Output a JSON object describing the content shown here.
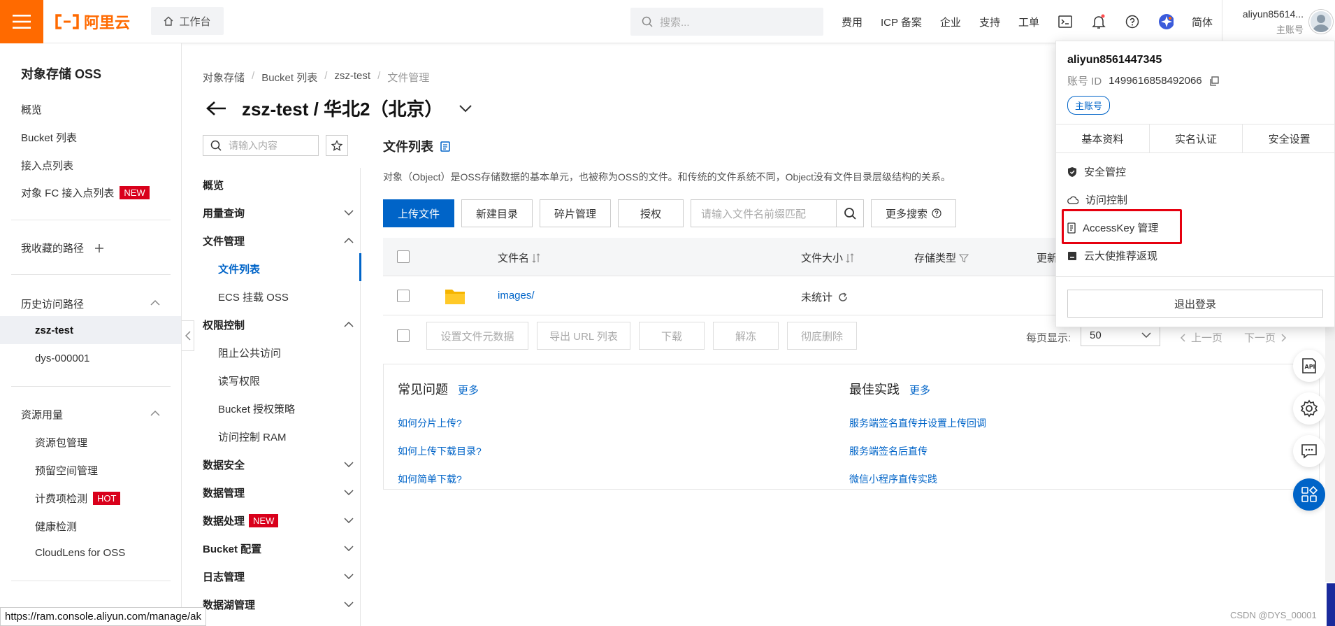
{
  "topbar": {
    "logo_text": "阿里云",
    "workbench": "工作台",
    "search_placeholder": "搜索...",
    "nav": [
      "费用",
      "ICP 备案",
      "企业",
      "支持",
      "工单"
    ],
    "lang": "简体",
    "user_name": "aliyun85614...",
    "user_role": "主账号"
  },
  "sidebar": {
    "title": "对象存储 OSS",
    "items": [
      "概览",
      "Bucket 列表",
      "接入点列表",
      "对象 FC 接入点列表"
    ],
    "fc_badge": "NEW",
    "favorites": "我收藏的路径",
    "history_title": "历史访问路径",
    "history": [
      "zsz-test",
      "dys-000001"
    ],
    "resources_title": "资源用量",
    "resources": [
      "资源包管理",
      "预留空间管理",
      "计费项检测",
      "健康检测",
      "CloudLens for OSS"
    ],
    "hot_badge": "HOT"
  },
  "breadcrumb": [
    "对象存储",
    "Bucket 列表",
    "zsz-test",
    "文件管理"
  ],
  "page_title": "zsz-test / 华北2（北京）",
  "bucket_nav": {
    "search_placeholder": "请输入内容",
    "items": [
      "概览",
      "用量查询",
      "文件管理",
      "文件列表",
      "ECS 挂载 OSS",
      "权限控制",
      "阻止公共访问",
      "读写权限",
      "Bucket 授权策略",
      "访问控制 RAM",
      "数据安全",
      "数据管理",
      "数据处理",
      "Bucket 配置",
      "日志管理",
      "数据湖管理"
    ],
    "new_badge": "NEW"
  },
  "main": {
    "title": "文件列表",
    "description": "对象（Object）是OSS存储数据的基本单元，也被称为OSS的文件。和传统的文件系统不同，Object没有文件目录层级结构的关系。",
    "buttons": [
      "上传文件",
      "新建目录",
      "碎片管理",
      "授权"
    ],
    "file_search_placeholder": "请输入文件名前缀匹配",
    "more_search": "更多搜索",
    "columns": [
      "文件名",
      "文件大小",
      "存储类型",
      "更新"
    ],
    "rows": [
      {
        "name": "images/",
        "size": "未统计"
      }
    ],
    "footer_buttons": [
      "设置文件元数据",
      "导出 URL 列表",
      "下载",
      "解冻",
      "彻底删除"
    ],
    "per_page_label": "每页显示:",
    "per_page": "50",
    "prev": "上一页",
    "next": "下一页"
  },
  "help": {
    "faq_title": "常见问题",
    "faq_more": "更多",
    "faq": [
      "如何分片上传?",
      "如何上传下载目录?",
      "如何简单下载?"
    ],
    "best_title": "最佳实践",
    "best_more": "更多",
    "best": [
      "服务端签名直传并设置上传回调",
      "服务端签名后直传",
      "微信小程序直传实践"
    ]
  },
  "user_dropdown": {
    "name": "aliyun8561447345",
    "id_label": "账号 ID",
    "id": "1499616858492066",
    "badge": "主账号",
    "tabs": [
      "基本资料",
      "实名认证",
      "安全设置"
    ],
    "items": [
      "安全管控",
      "访问控制",
      "AccessKey 管理",
      "云大使推荐返现"
    ],
    "logout": "退出登录"
  },
  "statusbar_url": "https://ram.console.aliyun.com/manage/ak",
  "watermark": "CSDN @DYS_00001",
  "colors": {
    "brand": "#ff6a00",
    "primary": "#0064c8",
    "badge": "#d9001b",
    "highlight": "#e6000f"
  }
}
